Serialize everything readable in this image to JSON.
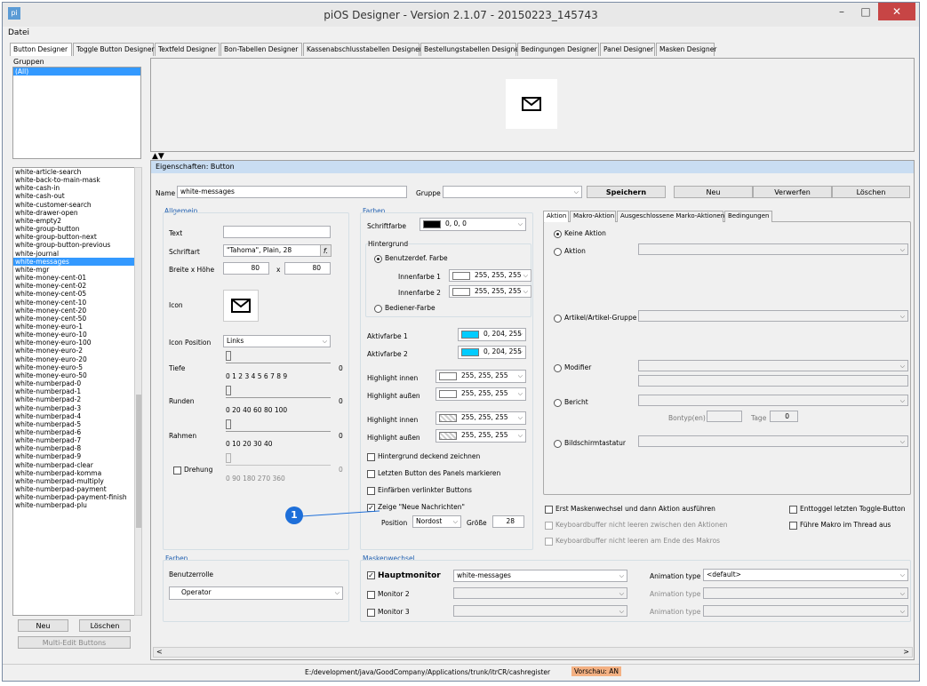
{
  "window": {
    "title": "piOS Designer - Version 2.1.07 - 20150223_145743",
    "minimize": "–",
    "maximize": "□",
    "close": "✕"
  },
  "menu": {
    "file": "Datei"
  },
  "tabs": [
    "Button Designer",
    "Toggle Button Designer",
    "Textfeld Designer",
    "Bon-Tabellen Designer",
    "Kassenabschlusstabellen Designer",
    "Bestellungstabellen Designer",
    "Bedingungen Designer",
    "Panel Designer",
    "Masken Designer"
  ],
  "groups": {
    "label": "Gruppen",
    "items": [
      "(All)"
    ]
  },
  "buttons_list": [
    "white-article-search",
    "white-back-to-main-mask",
    "white-cash-in",
    "white-cash-out",
    "white-customer-search",
    "white-drawer-open",
    "white-empty2",
    "white-group-button",
    "white-group-button-next",
    "white-group-button-previous",
    "white-journal",
    "white-messages",
    "white-mgr",
    "white-money-cent-01",
    "white-money-cent-02",
    "white-money-cent-05",
    "white-money-cent-10",
    "white-money-cent-20",
    "white-money-cent-50",
    "white-money-euro-1",
    "white-money-euro-10",
    "white-money-euro-100",
    "white-money-euro-2",
    "white-money-euro-20",
    "white-money-euro-5",
    "white-money-euro-50",
    "white-numberpad-0",
    "white-numberpad-1",
    "white-numberpad-2",
    "white-numberpad-3",
    "white-numberpad-4",
    "white-numberpad-5",
    "white-numberpad-6",
    "white-numberpad-7",
    "white-numberpad-8",
    "white-numberpad-9",
    "white-numberpad-clear",
    "white-numberpad-komma",
    "white-numberpad-multiply",
    "white-numberpad-payment",
    "white-numberpad-payment-finish",
    "white-numberpad-plu"
  ],
  "list_buttons": {
    "new": "Neu",
    "delete": "Löschen",
    "multi": "Multi-Edit Buttons"
  },
  "props": {
    "header": "Eigenschaften: Button",
    "name_label": "Name",
    "name_value": "white-messages",
    "group_label": "Gruppe",
    "group_value": "",
    "save": "Speichern",
    "new": "Neu",
    "discard": "Verwerfen",
    "delete": "Löschen"
  },
  "allgemein": {
    "title": "Allgemein",
    "text_label": "Text",
    "text_value": "",
    "font_label": "Schriftart",
    "font_value": "\"Tahoma\", Plain, 28",
    "font_btn": "f.",
    "size_label": "Breite x Höhe",
    "width": "80",
    "x": "x",
    "height": "80",
    "icon_label": "Icon",
    "iconpos_label": "Icon Position",
    "iconpos_value": "Links",
    "tiefe_label": "Tiefe",
    "tiefe_ticks": "0  1  2  3  4  5  6  7  8  9",
    "tiefe_val": "0",
    "runden_label": "Runden",
    "runden_ticks": "0    20   40   60   80  100",
    "runden_val": "0",
    "rahmen_label": "Rahmen",
    "rahmen_ticks": "0     10     20     30     40",
    "rahmen_val": "0",
    "drehung_label": "Drehung",
    "drehung_ticks": "0     90    180    270   360",
    "drehung_val": "0"
  },
  "farben": {
    "title": "Farben",
    "schrift_label": "Schriftfarbe",
    "schrift_value": "0, 0, 0",
    "schrift_color": "#000000",
    "bg_title": "Hintergrund",
    "benutzerdef": "Benutzerdef. Farbe",
    "inner1_label": "Innenfarbe 1",
    "inner1_value": "255, 255, 255",
    "inner2_label": "Innenfarbe 2",
    "inner2_value": "255, 255, 255",
    "bediener": "Bediener-Farbe",
    "aktiv1_label": "Aktivfarbe 1",
    "aktiv1_value": "0, 204, 255",
    "aktiv2_label": "Aktivfarbe 2",
    "aktiv2_value": "0, 204, 255",
    "aktiv_color": "#00ccff",
    "hl_in_label": "Highlight innen",
    "hl_in_value": "255, 255, 255",
    "hl_out_label": "Highlight außen",
    "hl_out_value": "255, 255, 255",
    "hl_in2_label": "Highlight innen",
    "hl_in2_value": "255, 255, 255",
    "hl_out2_label": "Highlight außen",
    "hl_out2_value": "255, 255, 255",
    "cb1": "Hintergrund deckend zeichnen",
    "cb2": "Letzten Button des Panels markieren",
    "cb3": "Einfärben verlinkter Buttons",
    "cb4": "Zeige \"Neue Nachrichten\"",
    "position_label": "Position",
    "position_value": "Nordost",
    "groesse_label": "Größe",
    "groesse_value": "28"
  },
  "aktion": {
    "tabs": [
      "Aktion",
      "Makro-Aktion",
      "Ausgeschlossene Marko-Aktionen",
      "Bedingungen"
    ],
    "keine": "Keine Aktion",
    "aktion": "Aktion",
    "artikel": "Artikel/Artikel-Gruppe",
    "modifier": "Modifier",
    "bericht": "Bericht",
    "bontyp": "Bontyp(en)",
    "tage": "Tage",
    "tage_value": "0",
    "bildschirm": "Bildschirmtastatur",
    "opt1": "Erst Maskenwechsel und dann Aktion ausführen",
    "opt2": "Keyboardbuffer nicht leeren zwischen den Aktionen",
    "opt3": "Keyboardbuffer nicht leeren am Ende des Makros",
    "opt4": "Enttoggel letzten Toggle-Button",
    "opt5": "Führe Makro im Thread aus"
  },
  "farben2": {
    "title": "Farben",
    "rolle_label": "Benutzerrolle",
    "rolle_value": "Operator"
  },
  "masken": {
    "title": "Maskenwechsel",
    "haupt": "Hauptmonitor",
    "haupt_value": "white-messages",
    "mon2": "Monitor 2",
    "mon3": "Monitor 3",
    "anim_label": "Animation type",
    "anim_value": "<default>"
  },
  "status": {
    "path": "E:/development/java/GoodCompany/Applications/trunk/itrCR/cashregister",
    "preview": "Vorschau: AN"
  },
  "callout": "1"
}
